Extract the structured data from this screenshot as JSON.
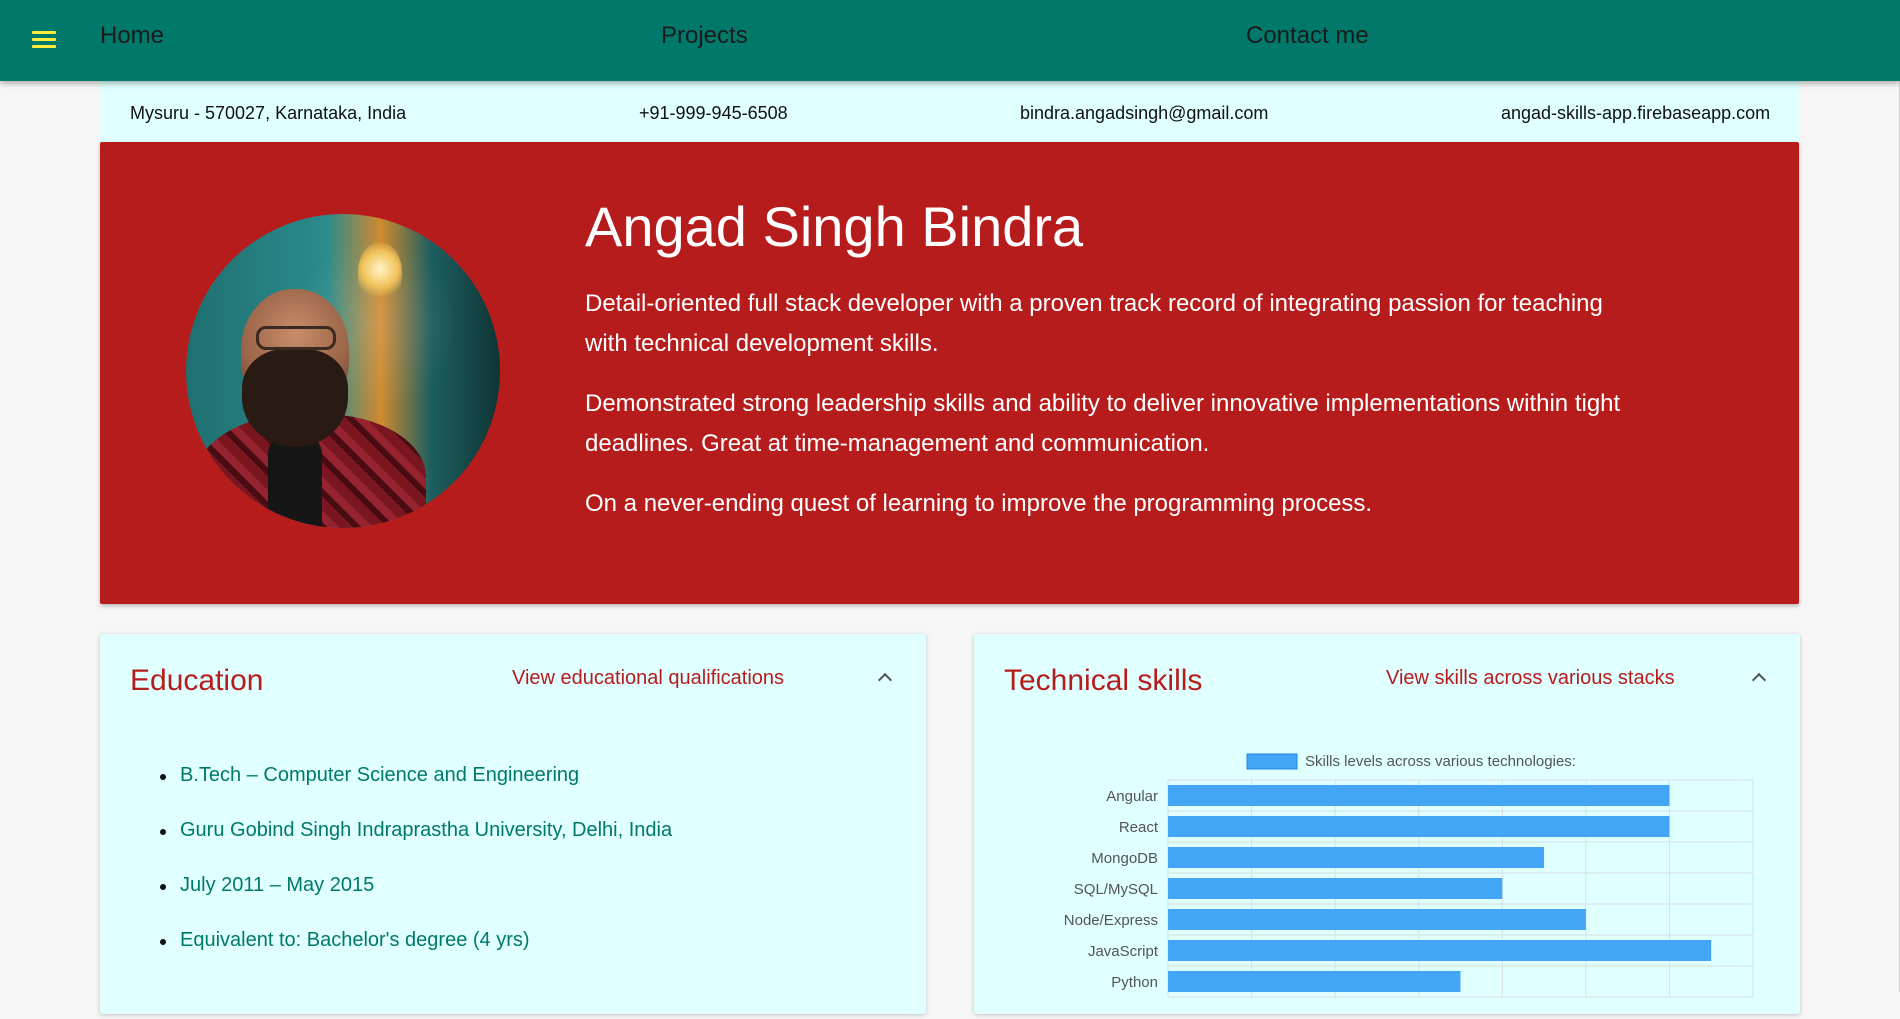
{
  "nav": {
    "home": "Home",
    "projects": "Projects",
    "contact": "Contact me",
    "menu_icon": "hamburger-menu-icon",
    "accent": "#00796b",
    "menu_icon_color": "#ffeb3b"
  },
  "contact": {
    "location": "Mysuru - 570027, Karnataka, India",
    "phone": "+91-999-945-6508",
    "email": "bindra.angadsingh@gmail.com",
    "website": "angad-skills-app.firebaseapp.com"
  },
  "hero": {
    "name": "Angad Singh Bindra",
    "p1": "Detail-oriented full stack developer with a proven track record of integrating passion for teaching with technical development skills.",
    "p2": "Demonstrated strong leadership skills and ability to deliver innovative implementations within tight deadlines. Great at time-management and communication.",
    "p3": "On a never-ending quest of learning to improve the programming process.",
    "background": "#b71c1c"
  },
  "education": {
    "title": "Education",
    "subtitle": "View educational qualifications",
    "items": [
      "B.Tech – Computer Science and Engineering",
      "Guru Gobind Singh Indraprastha University, Delhi, India",
      "July 2011 – May 2015",
      "Equivalent to: Bachelor's degree (4 yrs)"
    ]
  },
  "skills": {
    "title": "Technical skills",
    "subtitle": "View skills across various stacks"
  },
  "chart_data": {
    "type": "bar",
    "orientation": "horizontal",
    "categories": [
      "Angular",
      "React",
      "MongoDB",
      "SQL/MySQL",
      "Node/Express",
      "JavaScript",
      "Python"
    ],
    "series": [
      {
        "name": "Skills levels across various technologies:",
        "values": [
          6,
          6,
          4.5,
          4,
          5,
          6.5,
          3.5
        ]
      }
    ],
    "xlim": [
      0,
      7
    ],
    "grid": true,
    "legend": "top",
    "color": "#42a5f5"
  }
}
